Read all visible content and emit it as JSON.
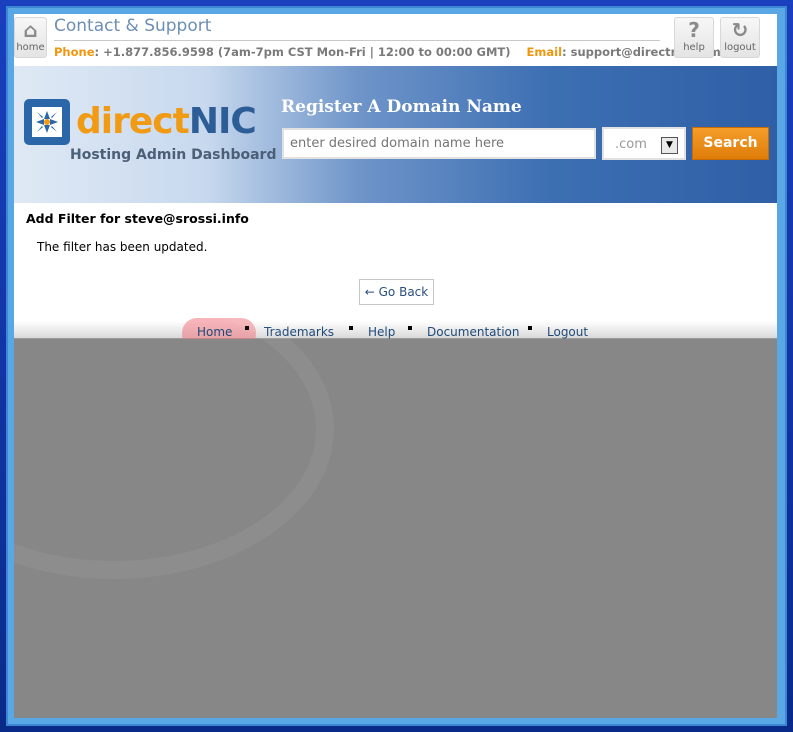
{
  "topbar": {
    "home_label": "home",
    "contact_title": "Contact & Support",
    "phone_label": "Phone",
    "phone_value": ": +1.877.856.9598 (7am-7pm CST Mon-Fri | 12:00 to 00:00 GMT)",
    "email_label": "Email",
    "email_value": ": support@directnic.com",
    "help_label": "help",
    "logout_label": "logout"
  },
  "header": {
    "logo_part1": "direct",
    "logo_part2": "NIC",
    "logo_subtitle": "Hosting Admin Dashboard",
    "register_title": "Register A Domain Name",
    "domain_placeholder": "enter desired domain name here",
    "tld_selected": ".com",
    "search_label": "Search"
  },
  "content": {
    "title": "Add Filter for steve@srossi.info",
    "status_message": "The filter has been updated.",
    "goback_label": "← Go Back"
  },
  "footer_nav": {
    "items": [
      "Home",
      "Trademarks",
      "Help",
      "Documentation",
      "Logout"
    ]
  },
  "colors": {
    "brand_orange": "#f19a13",
    "brand_blue": "#2d5d97",
    "link_blue": "#1f4a78",
    "background_gray": "#878787"
  }
}
